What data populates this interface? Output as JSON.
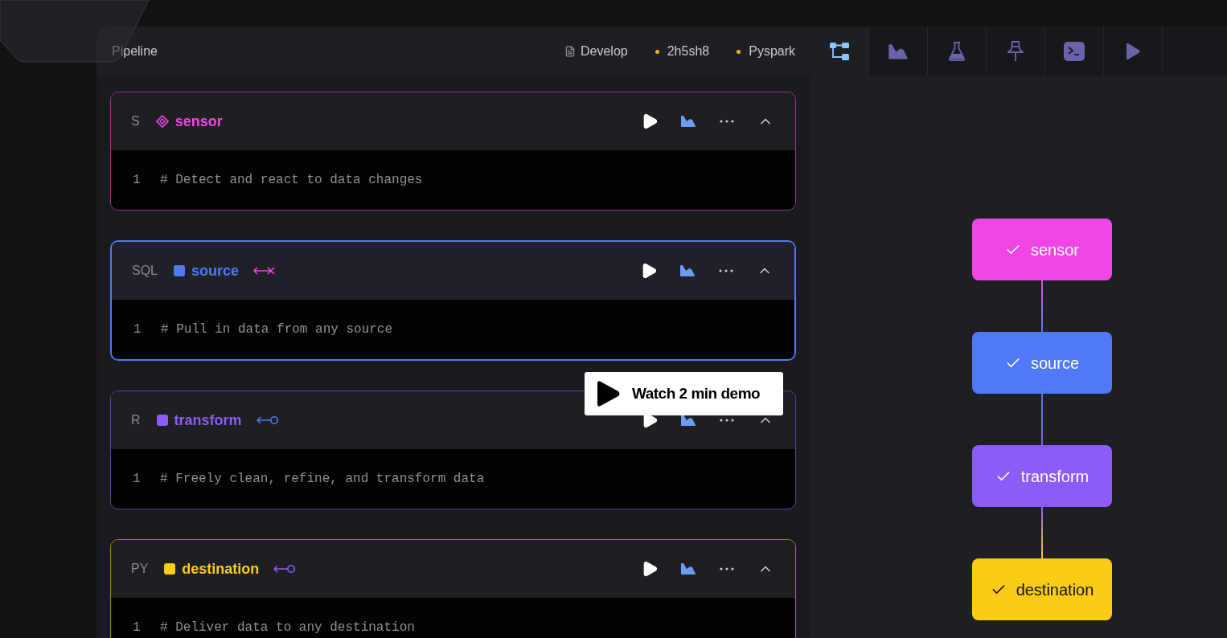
{
  "notebook": {
    "title": "Pipeline",
    "meta": [
      {
        "kind": "file",
        "label": "Develop"
      },
      {
        "kind": "dot",
        "label": "2h5sh8"
      },
      {
        "kind": "dot",
        "label": "Pyspark"
      }
    ]
  },
  "cells": [
    {
      "lang": "S",
      "name": "sensor",
      "kind": "diamond",
      "color": "#f046e6",
      "selected": false,
      "line_number": "1",
      "code": "# Detect and react to data changes"
    },
    {
      "lang": "SQL",
      "name": "source",
      "kind": "square",
      "color": "#4f79f7",
      "link": {
        "kind": "cut"
      },
      "selected": true,
      "line_number": "1",
      "code": "# Pull in data from any source"
    },
    {
      "lang": "R",
      "name": "transform",
      "kind": "square",
      "color": "#8d5cf6",
      "link": {
        "kind": "linked"
      },
      "selected": false,
      "line_number": "1",
      "code": "# Freely clean, refine, and transform data"
    },
    {
      "lang": "PY",
      "name": "destination",
      "kind": "square",
      "color": "#facc15",
      "link": {
        "kind": "linked"
      },
      "selected": false,
      "line_number": "1",
      "code": "# Deliver data to any destination"
    }
  ],
  "demo_button": {
    "label": "Watch 2 min demo"
  },
  "toolbar": [
    {
      "kind": "tree",
      "selected": true
    },
    {
      "kind": "chart",
      "selected": false
    },
    {
      "kind": "flask",
      "selected": false
    },
    {
      "kind": "pin",
      "selected": false
    },
    {
      "kind": "terminal",
      "selected": false
    },
    {
      "kind": "play",
      "selected": false
    }
  ],
  "graph": {
    "nodes": [
      {
        "name": "sensor",
        "color": "#f046e6",
        "checked": true
      },
      {
        "name": "source",
        "color": "#4f79f7",
        "checked": true
      },
      {
        "name": "transform",
        "color": "#8d5cf6",
        "checked": true
      },
      {
        "name": "destination",
        "color": "#facc15",
        "checked": true
      }
    ]
  }
}
